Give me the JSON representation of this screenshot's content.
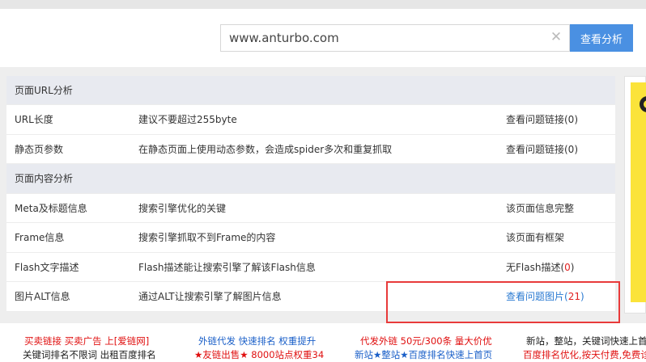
{
  "search": {
    "value": "www.anturbo.com",
    "button_label": "查看分析",
    "clear_glyph": "✕"
  },
  "report": {
    "rows": [
      {
        "type": "section",
        "label": "页面URL分析"
      },
      {
        "type": "item",
        "name": "URL长度",
        "description": "建议不要超过255byte",
        "result": "查看问题链接(0)"
      },
      {
        "type": "item",
        "name": "静态页参数",
        "description": "在静态页面上使用动态参数，会造成spider多次和重复抓取",
        "result": "查看问题链接(0)"
      },
      {
        "type": "section",
        "label": "页面内容分析"
      },
      {
        "type": "item",
        "name": "Meta及标题信息",
        "description": "搜索引擎优化的关键",
        "result": "该页面信息完整"
      },
      {
        "type": "item",
        "name": "Frame信息",
        "description": "搜索引擎抓取不到Frame的内容",
        "result": "该页面有框架"
      },
      {
        "type": "item",
        "name": "Flash文字描述",
        "description": "Flash描述能让搜索引擎了解该Flash信息",
        "result_prefix": "无Flash描述(",
        "result_count": "0",
        "result_suffix": ")"
      },
      {
        "type": "item",
        "name": "图片ALT信息",
        "description": "通过ALT让搜索引擎了解图片信息",
        "result_prefix": "查看问题图片(",
        "result_count": "21",
        "result_suffix": ")"
      }
    ]
  },
  "footer": {
    "ads": [
      {
        "text": "买卖链接 买卖广告 上[爱链网]",
        "color": "red"
      },
      {
        "text": "关键词排名不限词 出租百度排名",
        "color": "dark"
      },
      {
        "text": "外链代发 快速排名 权重提升",
        "color": "blue"
      },
      {
        "text": "★友链出售★ 8000站点权重34",
        "color": "red"
      },
      {
        "text": "代发外链 50元/300条 量大价优",
        "color": "red"
      },
      {
        "text": "新站★整站★百度排名快速上首页",
        "color": "blue"
      },
      {
        "text": "新站，整站，关键词快速上首",
        "color": "dark"
      },
      {
        "text": "百度排名优化,按天付费,免费诊",
        "color": "red"
      }
    ]
  },
  "colors": {
    "accent": "#4a90e2",
    "link": "#2a7ad2",
    "highlight_border": "#e83a3a",
    "section_bg": "#e8eaf0"
  }
}
